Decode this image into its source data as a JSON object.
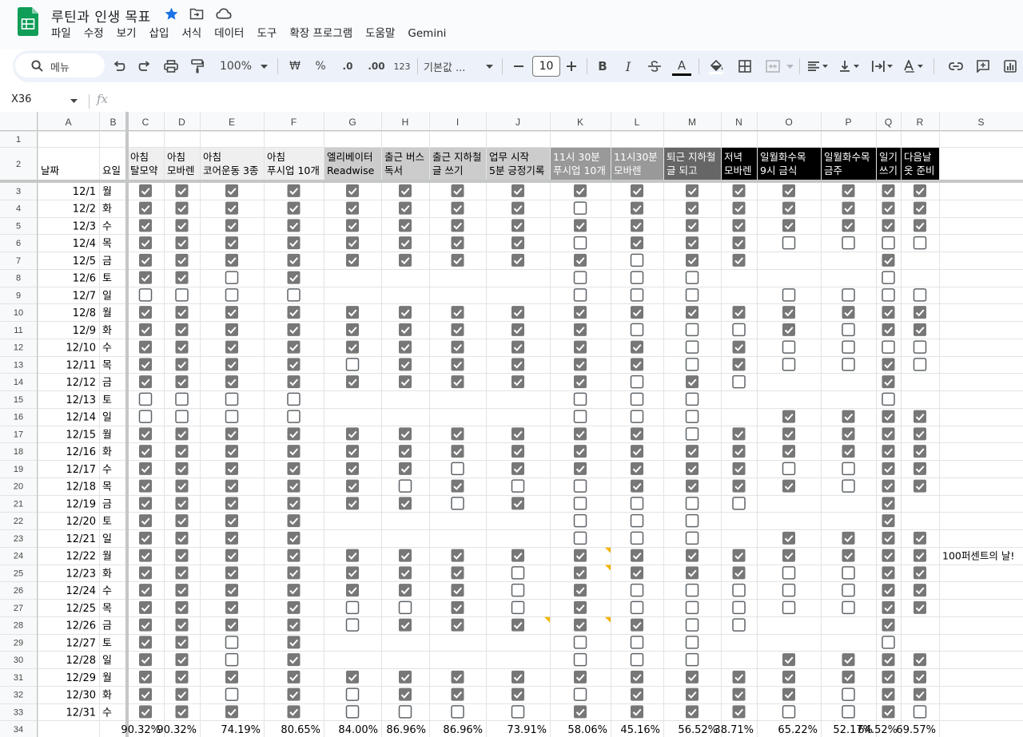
{
  "app": {
    "doc_title": "루틴과 인생 목표",
    "menus": [
      "파일",
      "수정",
      "보기",
      "삽입",
      "서식",
      "데이터",
      "도구",
      "확장 프로그램",
      "도움말",
      "Gemini"
    ]
  },
  "toolbar": {
    "search_label": "메뉴",
    "zoom": "100%",
    "currency": "₩",
    "percent": "%",
    "decrease_decimal": ".0",
    "increase_decimal": ".00",
    "number_format": "123",
    "font": "기본값 ...",
    "font_size": "10",
    "bold": "B",
    "italic": "I",
    "text_color": "A"
  },
  "formula_bar": {
    "cell_ref": "X36",
    "fx": "fx"
  },
  "sheet": {
    "column_letters": [
      "A",
      "B",
      "C",
      "D",
      "E",
      "F",
      "G",
      "H",
      "I",
      "J",
      "K",
      "L",
      "M",
      "N",
      "O",
      "P",
      "Q",
      "R",
      "S"
    ],
    "header_row": [
      {
        "line1": "날짜",
        "line2": ""
      },
      {
        "line1": "요일",
        "line2": ""
      },
      {
        "line1": "아침",
        "line2": "탈모약"
      },
      {
        "line1": "아침",
        "line2": "모바렌"
      },
      {
        "line1": "아침",
        "line2": "코어운동 3종"
      },
      {
        "line1": "아침",
        "line2": "푸시업 10개"
      },
      {
        "line1": "엘리베이터",
        "line2": "Readwise"
      },
      {
        "line1": "출근 버스",
        "line2": "독서"
      },
      {
        "line1": "출근 지하철",
        "line2": "글 쓰기"
      },
      {
        "line1": "업무 시작",
        "line2": "5분 긍정기록"
      },
      {
        "line1": "11시 30분",
        "line2": "푸시업 10개"
      },
      {
        "line1": "11시30분",
        "line2": "모바렌"
      },
      {
        "line1": "퇴근 지하철",
        "line2": "글 되고"
      },
      {
        "line1": "저녁",
        "line2": "모바렌"
      },
      {
        "line1": "일월화수목",
        "line2": "9시 금식"
      },
      {
        "line1": "일월화수목",
        "line2": "금주"
      },
      {
        "line1": "일기",
        "line2": "쓰기"
      },
      {
        "line1": "다음날",
        "line2": "옷 준비"
      }
    ],
    "header_fills": [
      "#ffffff",
      "#ffffff",
      "#efefef",
      "#efefef",
      "#efefef",
      "#efefef",
      "#cccccc",
      "#cccccc",
      "#cccccc",
      "#cccccc",
      "#999999",
      "#999999",
      "#666666",
      "#000000",
      "#000000",
      "#000000",
      "#000000",
      "#000000"
    ],
    "header_text_colors": [
      "#000000",
      "#000000",
      "#000000",
      "#000000",
      "#000000",
      "#000000",
      "#000000",
      "#000000",
      "#000000",
      "#000000",
      "#ffffff",
      "#ffffff",
      "#ffffff",
      "#ffffff",
      "#ffffff",
      "#ffffff",
      "#ffffff",
      "#ffffff"
    ],
    "rows": [
      {
        "date": "12/1",
        "day": "월",
        "checks": "1111111111111111"
      },
      {
        "date": "12/2",
        "day": "화",
        "checks": "1111111101111111"
      },
      {
        "date": "12/3",
        "day": "수",
        "checks": "1111111111111111"
      },
      {
        "date": "12/4",
        "day": "목",
        "checks": "1111111101110000"
      },
      {
        "date": "12/5",
        "day": "금",
        "checks": "111111111011--1-"
      },
      {
        "date": "12/6",
        "day": "토",
        "checks": "1101----000---0-"
      },
      {
        "date": "12/7",
        "day": "일",
        "checks": "0000----000-0000"
      },
      {
        "date": "12/8",
        "day": "월",
        "checks": "1111111111111111"
      },
      {
        "date": "12/9",
        "day": "화",
        "checks": "1111111110001011"
      },
      {
        "date": "12/10",
        "day": "수",
        "checks": "1111111111010000"
      },
      {
        "date": "12/11",
        "day": "목",
        "checks": "1111011111010010"
      },
      {
        "date": "12/12",
        "day": "금",
        "checks": "111111111010--1-"
      },
      {
        "date": "12/13",
        "day": "토",
        "checks": "0000----000---0-"
      },
      {
        "date": "12/14",
        "day": "일",
        "checks": "0000----000-1111"
      },
      {
        "date": "12/15",
        "day": "월",
        "checks": "1111111111011111"
      },
      {
        "date": "12/16",
        "day": "화",
        "checks": "1111111111111111"
      },
      {
        "date": "12/17",
        "day": "수",
        "checks": "1111110111110011"
      },
      {
        "date": "12/18",
        "day": "목",
        "checks": "1111101001111011"
      },
      {
        "date": "12/19",
        "day": "금",
        "checks": "111111010000--1-"
      },
      {
        "date": "12/20",
        "day": "토",
        "checks": "1111----000---1-"
      },
      {
        "date": "12/21",
        "day": "일",
        "checks": "1111----000-1111"
      },
      {
        "date": "12/22",
        "day": "월",
        "checks": "1111111111111111"
      },
      {
        "date": "12/23",
        "day": "화",
        "checks": "1111111011110011"
      },
      {
        "date": "12/24",
        "day": "수",
        "checks": "1111111010000011"
      },
      {
        "date": "12/25",
        "day": "목",
        "checks": "1111001010000011"
      },
      {
        "date": "12/26",
        "day": "금",
        "checks": "111101111100--1-"
      },
      {
        "date": "12/27",
        "day": "토",
        "checks": "1101----000---0-"
      },
      {
        "date": "12/28",
        "day": "일",
        "checks": "1101----000-1111"
      },
      {
        "date": "12/29",
        "day": "월",
        "checks": "1111111111111111"
      },
      {
        "date": "12/30",
        "day": "화",
        "checks": "1101011101111011"
      },
      {
        "date": "12/31",
        "day": "수",
        "checks": "1111000011110010"
      }
    ],
    "totals": [
      "90.32%",
      "90.32%",
      "74.19%",
      "80.65%",
      "84.00%",
      "86.96%",
      "86.96%",
      "73.91%",
      "58.06%",
      "45.16%",
      "56.52%",
      "38.71%",
      "65.22%",
      "52.17%",
      "64.52%",
      "69.57%"
    ],
    "note_row": 24,
    "note_text": "100퍼센트의 날!",
    "weekend_colors": {
      "토": "#1155cc",
      "일": "#cc0000"
    }
  }
}
